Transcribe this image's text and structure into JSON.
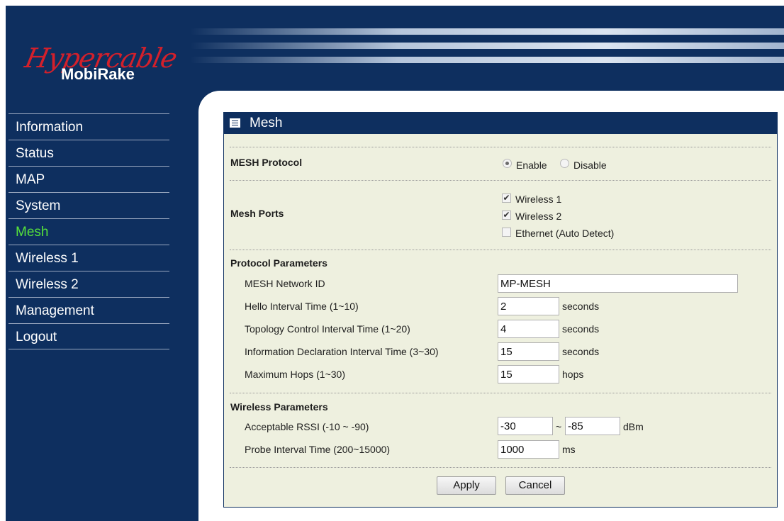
{
  "brand": {
    "script": "Hypercable",
    "product": "MobiRake"
  },
  "nav": [
    {
      "label": "Information",
      "active": false
    },
    {
      "label": "Status",
      "active": false
    },
    {
      "label": "MAP",
      "active": false
    },
    {
      "label": "System",
      "active": false
    },
    {
      "label": "Mesh",
      "active": true
    },
    {
      "label": "Wireless 1",
      "active": false
    },
    {
      "label": "Wireless 2",
      "active": false
    },
    {
      "label": "Management",
      "active": false
    },
    {
      "label": "Logout",
      "active": false
    }
  ],
  "panel": {
    "title": "Mesh"
  },
  "mesh_protocol": {
    "label": "MESH Protocol",
    "enable": "Enable",
    "disable": "Disable",
    "selected": "Enable"
  },
  "mesh_ports": {
    "label": "Mesh Ports",
    "options": [
      {
        "label": "Wireless 1",
        "checked": true
      },
      {
        "label": "Wireless 2",
        "checked": true
      },
      {
        "label": "Ethernet (Auto Detect)",
        "checked": false
      }
    ]
  },
  "protocol_params": {
    "heading": "Protocol Parameters",
    "network_id": {
      "label": "MESH Network ID",
      "value": "MP-MESH"
    },
    "hello": {
      "label": "Hello Interval Time (1~10)",
      "value": "2",
      "unit": "seconds"
    },
    "topology": {
      "label": "Topology Control Interval Time (1~20)",
      "value": "4",
      "unit": "seconds"
    },
    "info_decl": {
      "label": "Information Declaration Interval Time (3~30)",
      "value": "15",
      "unit": "seconds"
    },
    "max_hops": {
      "label": "Maximum Hops (1~30)",
      "value": "15",
      "unit": "hops"
    }
  },
  "wireless_params": {
    "heading": "Wireless Parameters",
    "rssi": {
      "label": "Acceptable RSSI (-10 ~ -90)",
      "min": "-30",
      "tilde": "~",
      "max": "-85",
      "unit": "dBm"
    },
    "probe": {
      "label": "Probe Interval Time (200~15000)",
      "value": "1000",
      "unit": "ms"
    }
  },
  "buttons": {
    "apply": "Apply",
    "cancel": "Cancel"
  },
  "colors": {
    "navy": "#0e2f5f",
    "active_nav": "#56e13b",
    "logo_red": "#d3202b",
    "panel_bg": "#eef0df"
  }
}
